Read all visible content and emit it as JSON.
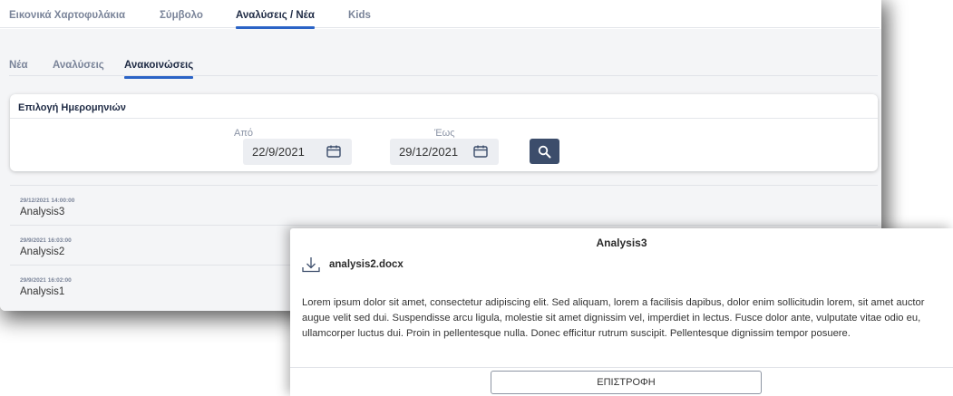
{
  "top_tabs": [
    {
      "label": "Εικονικά Χαρτοφυλάκια"
    },
    {
      "label": "Σύμβολο"
    },
    {
      "label": "Αναλύσεις / Νέα"
    },
    {
      "label": "Kids"
    }
  ],
  "sub_tabs": [
    {
      "label": "Νέα"
    },
    {
      "label": "Αναλύσεις"
    },
    {
      "label": "Ανακοινώσεις"
    }
  ],
  "date_filter": {
    "title": "Επιλογή Ημερομηνιών",
    "from_label": "Από",
    "from_value": "22/9/2021",
    "to_label": "Έως",
    "to_value": "29/12/2021"
  },
  "items": [
    {
      "time": "29/12/2021 14:00:00",
      "title": "Analysis3"
    },
    {
      "time": "29/9/2021 16:03:00",
      "title": "Analysis2"
    },
    {
      "time": "29/9/2021 16:02:00",
      "title": "Analysis1"
    }
  ],
  "modal": {
    "title": "Analysis3",
    "file_name": "analysis2.docx",
    "body": "Lorem ipsum dolor sit amet, consectetur adipiscing elit. Sed aliquam, lorem a facilisis dapibus, dolor enim sollicitudin lorem, sit amet auctor augue velit sed dui. Suspendisse arcu ligula, molestie sit amet dignissim vel, imperdiet in lectus. Fusce dolor ante, vulputate vitae odio eu, ullamcorper luctus dui. Proin in pellentesque nulla. Donec efficitur rutrum suscipit. Pellentesque dignissim tempor posuere.",
    "back_label": "ΕΠΙΣΤΡΟΦΗ"
  },
  "icons": {
    "calendar": "calendar-icon",
    "search": "search-icon",
    "download": "download-icon"
  },
  "colors": {
    "accent": "#2a63c6",
    "primary_dark": "#3c4d6b",
    "background": "#f4f5f7"
  }
}
